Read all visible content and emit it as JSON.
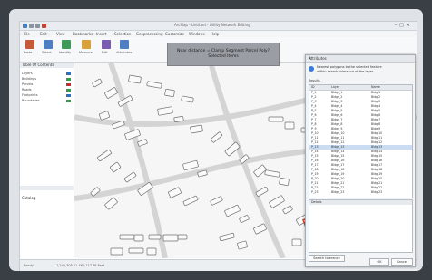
{
  "window": {
    "title": "ArcMap - Untitled - Utility Network Editing"
  },
  "menu": [
    {
      "label": "File"
    },
    {
      "label": "Edit"
    },
    {
      "label": "View"
    },
    {
      "label": "Bookmarks"
    },
    {
      "label": "Insert"
    },
    {
      "label": "Selection"
    },
    {
      "label": "Geoprocessing"
    },
    {
      "label": "Customize"
    },
    {
      "label": "Windows"
    },
    {
      "label": "Help"
    }
  ],
  "ribbon": {
    "buttons": [
      {
        "label": "Paste",
        "color": "#c85a3c"
      },
      {
        "label": "Select",
        "color": "#4d7fc2"
      },
      {
        "label": "Identify",
        "color": "#3f9a5a"
      },
      {
        "label": "Measure",
        "color": "#d9a13a"
      },
      {
        "label": "Edit",
        "color": "#7a5cb0"
      },
      {
        "label": "Attributes",
        "color": "#4d7fc2"
      }
    ]
  },
  "overlay": {
    "line1": "Near distance = Clamp Segment Parcel Poly?",
    "line2": "Selected Items"
  },
  "left_panel": {
    "header": "Table Of Contents",
    "rows": [
      {
        "label": "Layers",
        "color": "#2b6fc7"
      },
      {
        "label": "Buildings",
        "color": "#2f9e44"
      },
      {
        "label": "Parcels",
        "color": "#c92a2a"
      },
      {
        "label": "Roads",
        "color": "#2f9e44"
      },
      {
        "label": "Footprints",
        "color": "#2b6fc7"
      },
      {
        "label": "Boundaries",
        "color": "#2f9e44"
      }
    ],
    "footer_header": "Catalog"
  },
  "dialog": {
    "title": "Attributes",
    "info_line1": "Nearest polygons to the selected feature",
    "info_line2": "within search tolerance of the layer",
    "list_label": "Results",
    "columns": [
      "ID",
      "Layer",
      "Name"
    ],
    "rows": [
      {
        "id": "P_1",
        "layer": "Bldgs_1",
        "name": "Bldg 1"
      },
      {
        "id": "P_2",
        "layer": "Bldgs_2",
        "name": "Bldg 2"
      },
      {
        "id": "P_3",
        "layer": "Bldgs_3",
        "name": "Bldg 3"
      },
      {
        "id": "P_4",
        "layer": "Bldgs_4",
        "name": "Bldg 4"
      },
      {
        "id": "P_5",
        "layer": "Bldgs_5",
        "name": "Bldg 5"
      },
      {
        "id": "P_6",
        "layer": "Bldgs_6",
        "name": "Bldg 6"
      },
      {
        "id": "P_7",
        "layer": "Bldgs_7",
        "name": "Bldg 7"
      },
      {
        "id": "P_8",
        "layer": "Bldgs_8",
        "name": "Bldg 8"
      },
      {
        "id": "P_9",
        "layer": "Bldgs_9",
        "name": "Bldg 9"
      },
      {
        "id": "P_10",
        "layer": "Bldgs_10",
        "name": "Bldg 10"
      },
      {
        "id": "P_11",
        "layer": "Bldgs_11",
        "name": "Bldg 11"
      },
      {
        "id": "P_12",
        "layer": "Bldgs_12",
        "name": "Bldg 12"
      },
      {
        "id": "P_13",
        "layer": "Bldgs_13",
        "name": "Bldg 13"
      },
      {
        "id": "P_14",
        "layer": "Bldgs_14",
        "name": "Bldg 14"
      },
      {
        "id": "P_15",
        "layer": "Bldgs_15",
        "name": "Bldg 15"
      },
      {
        "id": "P_16",
        "layer": "Bldgs_16",
        "name": "Bldg 16"
      },
      {
        "id": "P_17",
        "layer": "Bldgs_17",
        "name": "Bldg 17"
      },
      {
        "id": "P_18",
        "layer": "Bldgs_18",
        "name": "Bldg 18"
      },
      {
        "id": "P_19",
        "layer": "Bldgs_19",
        "name": "Bldg 19"
      },
      {
        "id": "P_20",
        "layer": "Bldgs_20",
        "name": "Bldg 20"
      },
      {
        "id": "P_21",
        "layer": "Bldgs_21",
        "name": "Bldg 21"
      },
      {
        "id": "P_22",
        "layer": "Bldgs_22",
        "name": "Bldg 22"
      },
      {
        "id": "P_23",
        "layer": "Bldgs_23",
        "name": "Bldg 23"
      }
    ],
    "lower_header": "Details",
    "footer_field": "Search tolerance",
    "ok_label": "OK",
    "cancel_label": "Cancel"
  },
  "status": {
    "left": "Ready",
    "coords": "1,245,305.21  462,117.88 Feet"
  }
}
